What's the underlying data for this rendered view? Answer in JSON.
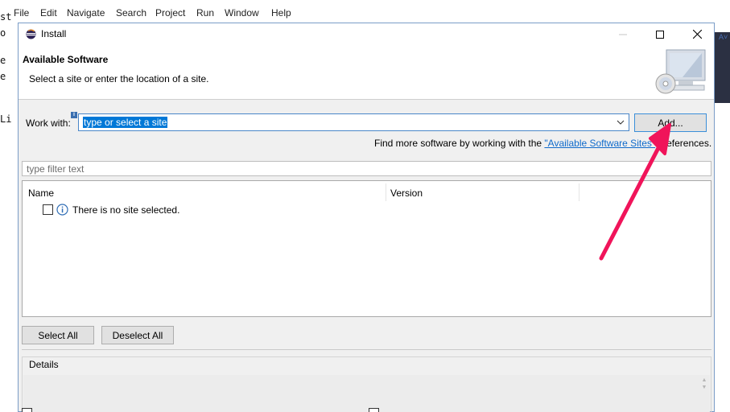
{
  "ide": {
    "menu": [
      "File",
      "Edit",
      "Navigate",
      "Search",
      "Project",
      "Run",
      "Window",
      "Help"
    ],
    "code_fragments": [
      "st",
      "o",
      "e",
      "e",
      "Li"
    ],
    "right_mark": "A˅"
  },
  "dialog": {
    "title": "Install",
    "header": {
      "title": "Available Software",
      "description": "Select a site or enter the location of a site."
    },
    "work_with": {
      "label": "Work with:",
      "value": "type or select a site",
      "add_button": "Add..."
    },
    "find_more": {
      "prefix": "Find more software by working with the ",
      "link": "\"Available Software Sites\"",
      "suffix": " preferences."
    },
    "filter": {
      "placeholder": "type filter text"
    },
    "table": {
      "columns": [
        "Name",
        "Version"
      ],
      "rows": [
        {
          "label": "There is no site selected.",
          "checked": false
        }
      ]
    },
    "buttons": {
      "select_all": "Select All",
      "deselect_all": "Deselect All"
    },
    "details": {
      "label": "Details"
    }
  },
  "colors": {
    "accent": "#0078d7",
    "link": "#0f6acb",
    "annotation_arrow": "#f0145a"
  }
}
